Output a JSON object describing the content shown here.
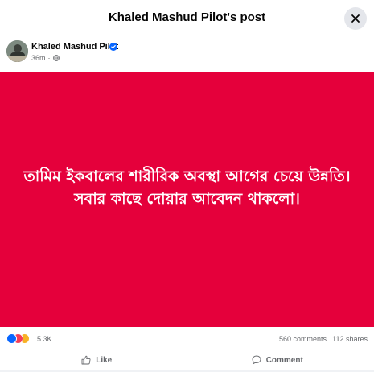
{
  "header": {
    "title": "Khaled Mashud Pilot's post"
  },
  "post": {
    "author": "Khaled Mashud Pilot",
    "time": "36m",
    "text": "তামিম ইকবালের শারীরিক অবস্থা আগের চেয়ে উন্নতি। সবার কাছে দোয়ার আবেদন থাকলো।",
    "background_color": "#e5003b"
  },
  "stats": {
    "reactions_count": "5.3K",
    "comments": "560 comments",
    "shares": "112 shares"
  },
  "actions": {
    "like": "Like",
    "comment": "Comment"
  },
  "icons": {
    "close": "close-icon",
    "verified": "verified-badge-icon",
    "globe": "globe-icon",
    "like": "thumbs-up-icon",
    "comment": "comment-bubble-icon"
  }
}
